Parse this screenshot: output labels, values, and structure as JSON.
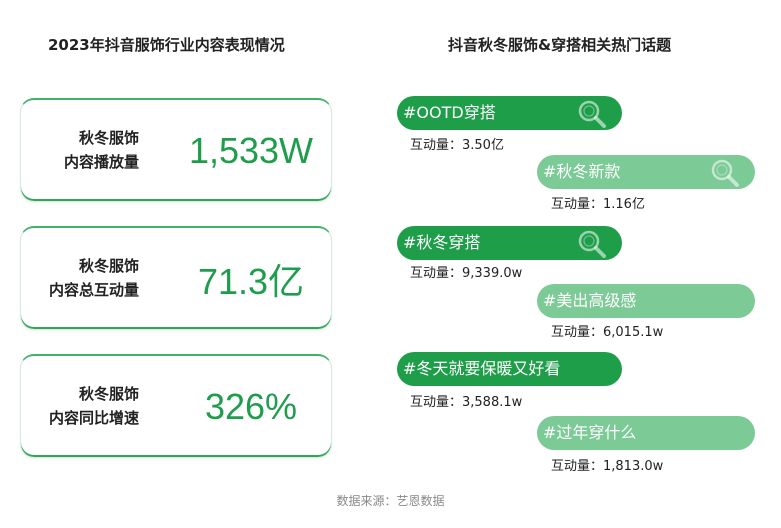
{
  "left_title": "2023年抖音服饰行业内容表现情况",
  "right_title": "抖音秋冬服饰&穿搭相关热门话题",
  "stats": [
    {
      "label_1": "秋冬服饰",
      "label_2": "内容播放量",
      "value": "1,533W"
    },
    {
      "label_1": "秋冬服饰",
      "label_2": "内容总互动量",
      "value": "71.3亿"
    },
    {
      "label_1": "秋冬服饰",
      "label_2": "内容同比增速",
      "value": "326%"
    }
  ],
  "chart_data": {
    "type": "table",
    "topics": [
      {
        "name": "#OOTD穿搭",
        "interaction": "互动量：3.50亿"
      },
      {
        "name": "#秋冬新款",
        "interaction": "互动量：1.16亿"
      },
      {
        "name": "#秋冬穿搭",
        "interaction": "互动量：9,339.0w"
      },
      {
        "name": "#美出高级感",
        "interaction": "互动量：6,015.1w"
      },
      {
        "name": "#冬天就要保暖又好看",
        "interaction": "互动量：3,588.1w"
      },
      {
        "name": "#过年穿什么",
        "interaction": "互动量：1,813.0w"
      }
    ]
  },
  "colors": {
    "dark_green": "#1f9e4a",
    "light_green": "#7cca96",
    "value_green": "#1e9e4c"
  },
  "icon": "magnifier-icon",
  "source": "数据来源：艺恩数据"
}
